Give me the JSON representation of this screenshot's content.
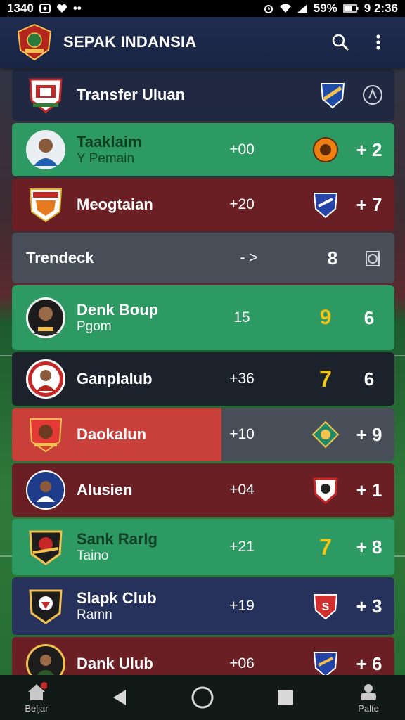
{
  "status_bar": {
    "time_left": "1340",
    "battery": "59%",
    "time_right": "9 2:36"
  },
  "app_bar": {
    "title": "SEPAK INDANSIA"
  },
  "rows": [
    {
      "name": "Transfer Uluan",
      "sub": "",
      "delta": "",
      "badge": "",
      "score": ""
    },
    {
      "name": "Taaklaim",
      "sub": "Y Pemain",
      "delta": "+00",
      "badge": "",
      "score": "+ 2"
    },
    {
      "name": "Meogtaian",
      "sub": "",
      "delta": "+20",
      "badge": "",
      "score": "+ 7"
    },
    {
      "name": "Trendeck",
      "sub": "",
      "delta": "- >",
      "badge": "8",
      "score": ""
    },
    {
      "name": "Denk Boup",
      "sub": "Pgom",
      "delta": "15",
      "badge": "9",
      "score": "6"
    },
    {
      "name": "Ganplalub",
      "sub": "",
      "delta": "+36",
      "badge": "7",
      "score": "6"
    },
    {
      "name": "Daokalun",
      "sub": "",
      "delta": "+10",
      "badge": "",
      "score": "+ 9"
    },
    {
      "name": "Alusien",
      "sub": "",
      "delta": "+04",
      "badge": "",
      "score": "+ 1"
    },
    {
      "name": "Sank Rarlg",
      "sub": "Taino",
      "delta": "+21",
      "badge": "7",
      "score": "+ 8"
    },
    {
      "name": "Slapk Club",
      "sub": "Ramn",
      "delta": "+19",
      "badge": "",
      "score": "+ 3"
    },
    {
      "name": "Dank Ulub",
      "sub": "",
      "delta": "+06",
      "badge": "",
      "score": "+ 6"
    }
  ],
  "bottom_nav": {
    "home_label": "Beljar",
    "profile_label": "Palte"
  },
  "colors": {
    "green": "#2e9a63",
    "maroon": "#6a1f24",
    "navy": "#26315c",
    "yellow": "#f0c419"
  }
}
